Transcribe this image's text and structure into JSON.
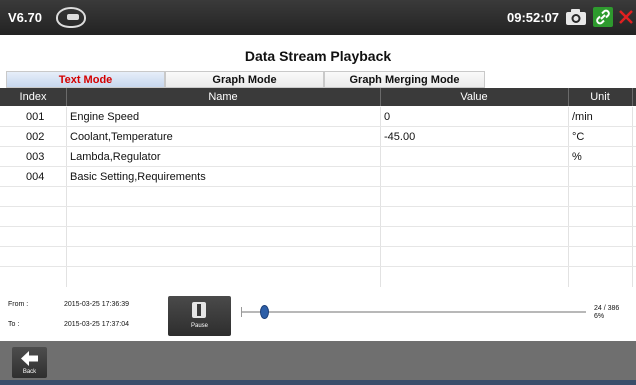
{
  "topbar": {
    "version": "V6.70",
    "vci_icon": "vci-connector-icon",
    "clock": "09:52:07",
    "icons": [
      "camera-icon",
      "link-icon",
      "close-icon"
    ],
    "colors": {
      "link": "#2e9a2e",
      "close": "#e02020"
    }
  },
  "page": {
    "title": "Data Stream Playback"
  },
  "tabs": [
    {
      "label": "Text Mode",
      "active": true
    },
    {
      "label": "Graph Mode",
      "active": false
    },
    {
      "label": "Graph Merging Mode",
      "active": false
    }
  ],
  "table": {
    "headers": {
      "index": "Index",
      "name": "Name",
      "value": "Value",
      "unit": "Unit"
    },
    "rows": [
      {
        "index": "001",
        "name": "Engine Speed",
        "value": "0",
        "unit": "/min"
      },
      {
        "index": "002",
        "name": "Coolant,Temperature",
        "value": "-45.00",
        "unit": "°C"
      },
      {
        "index": "003",
        "name": "Lambda,Regulator",
        "value": "",
        "unit": "%"
      },
      {
        "index": "004",
        "name": "Basic Setting,Requirements",
        "value": "",
        "unit": ""
      }
    ]
  },
  "playback": {
    "from_label": "From :",
    "from_time": "2015-03-25 17:36:39",
    "to_label": "To :",
    "to_time": "2015-03-25 17:37:04",
    "pause_label": "Pause",
    "position_text": "24 / 386",
    "percent_text": "6%",
    "progress_fraction": 0.06
  },
  "bottombar": {
    "back_label": "Back"
  }
}
